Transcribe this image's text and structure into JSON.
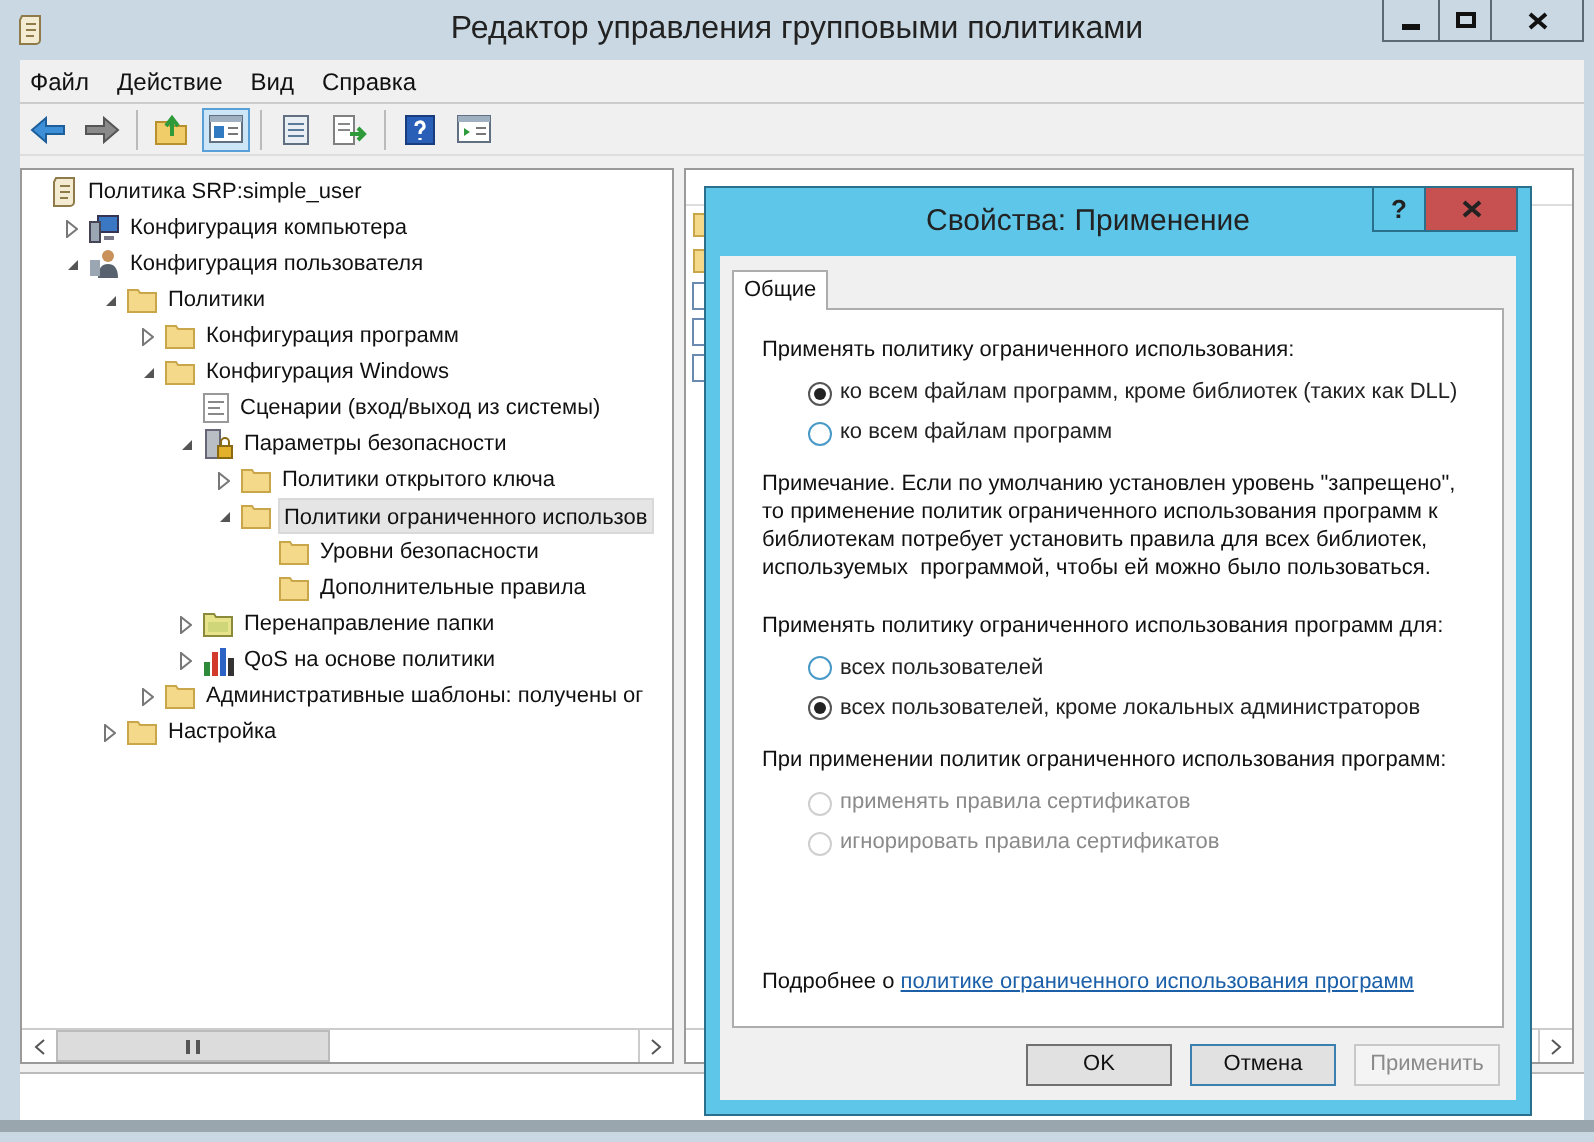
{
  "window": {
    "title": "Редактор управления групповыми политиками"
  },
  "menu": [
    "Файл",
    "Действие",
    "Вид",
    "Справка"
  ],
  "toolbar": [
    {
      "kind": "back",
      "pressed": false
    },
    {
      "kind": "forward",
      "pressed": false
    },
    {
      "kind": "sep"
    },
    {
      "kind": "up",
      "pressed": false
    },
    {
      "kind": "tree",
      "pressed": true
    },
    {
      "kind": "sep"
    },
    {
      "kind": "properties",
      "pressed": false
    },
    {
      "kind": "export",
      "pressed": false
    },
    {
      "kind": "sep"
    },
    {
      "kind": "help",
      "pressed": false
    },
    {
      "kind": "pane",
      "pressed": false
    }
  ],
  "tree": [
    {
      "label": "Политика SRP:simple_user",
      "kind": "policy",
      "selected": false,
      "children": [
        {
          "label": "Конфигурация компьютера",
          "kind": "computer",
          "expanded": false,
          "selected": false
        },
        {
          "label": "Конфигурация пользователя",
          "kind": "user",
          "expanded": true,
          "selected": false,
          "children": [
            {
              "label": "Политики",
              "kind": "folder",
              "expanded": true,
              "selected": false,
              "children": [
                {
                  "label": "Конфигурация программ",
                  "kind": "folder",
                  "expanded": false,
                  "selected": false
                },
                {
                  "label": "Конфигурация Windows",
                  "kind": "folder",
                  "expanded": true,
                  "selected": false,
                  "children": [
                    {
                      "label": "Сценарии (вход/выход из системы)",
                      "kind": "script",
                      "selected": false
                    },
                    {
                      "label": "Параметры безопасности",
                      "kind": "security",
                      "expanded": true,
                      "selected": false,
                      "children": [
                        {
                          "label": "Политики открытого ключа",
                          "kind": "folder",
                          "expanded": false,
                          "selected": false
                        },
                        {
                          "label": "Политики ограниченного использов",
                          "kind": "folder",
                          "expanded": true,
                          "selected": true,
                          "children": [
                            {
                              "label": "Уровни безопасности",
                              "kind": "folder",
                              "selected": false
                            },
                            {
                              "label": "Дополнительные правила",
                              "kind": "folder",
                              "selected": false
                            }
                          ]
                        }
                      ]
                    },
                    {
                      "label": "Перенаправление папки",
                      "kind": "redirect",
                      "expanded": false,
                      "selected": false
                    },
                    {
                      "label": "QoS на основе политики",
                      "kind": "qos",
                      "expanded": false,
                      "selected": false
                    }
                  ]
                },
                {
                  "label": "Административные шаблоны: получены ог",
                  "kind": "folder",
                  "expanded": false,
                  "selected": false
                }
              ]
            },
            {
              "label": "Настройка",
              "kind": "folder",
              "expanded": false,
              "selected": false
            }
          ]
        }
      ]
    }
  ],
  "right_pane": {
    "items": [
      {
        "kind": "folder"
      },
      {
        "kind": "folder"
      },
      {
        "kind": "file"
      },
      {
        "kind": "file"
      },
      {
        "kind": "file"
      }
    ]
  },
  "dialog": {
    "title": "Свойства: Применение",
    "help_button": "?",
    "tabs": [
      {
        "label": "Общие",
        "selected": true
      }
    ],
    "sections": [
      {
        "kind": "radio-group",
        "label": "Применять политику ограниченного использования:",
        "options": [
          {
            "label": "ко всем файлам программ, кроме библиотек (таких как DLL)",
            "selected": true,
            "disabled": false
          },
          {
            "label": "ко всем файлам программ",
            "selected": false,
            "disabled": false
          }
        ]
      },
      {
        "kind": "note",
        "text": "Примечание. Если по умолчанию установлен уровень \"запрещено\", то применение политик ограниченного использования программ к библиотекам потребует установить правила для всех библиотек, используемых  программой, чтобы ей можно было пользоваться."
      },
      {
        "kind": "radio-group",
        "label": "Применять политику ограниченного использования программ для:",
        "options": [
          {
            "label": "всех пользователей",
            "selected": false,
            "disabled": false
          },
          {
            "label": "всех пользователей, кроме локальных администраторов",
            "selected": true,
            "disabled": false
          }
        ]
      },
      {
        "kind": "radio-group",
        "label": "При применении политик ограниченного использования программ:",
        "options": [
          {
            "label": "применять правила сертификатов",
            "selected": false,
            "disabled": true
          },
          {
            "label": "игнорировать правила сертификатов",
            "selected": false,
            "disabled": true
          }
        ]
      }
    ],
    "more_info": {
      "text": "Подробнее о",
      "link": "политике ограниченного использования программ"
    },
    "buttons": [
      {
        "label": "OK",
        "disabled": false,
        "focused": false
      },
      {
        "label": "Отмена",
        "disabled": false,
        "focused": true
      },
      {
        "label": "Применить",
        "disabled": true,
        "focused": false
      }
    ]
  }
}
